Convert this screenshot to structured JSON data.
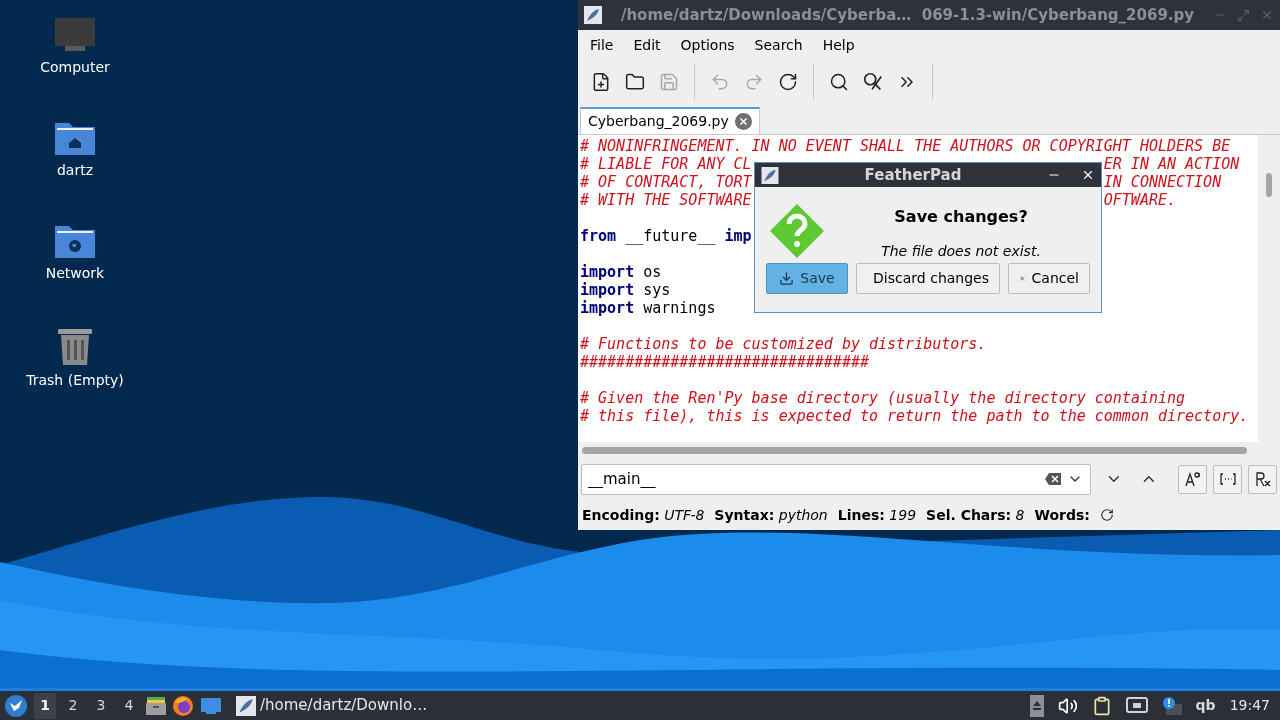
{
  "desktop_icons": [
    {
      "kind": "computer",
      "label": "Computer"
    },
    {
      "kind": "home",
      "label": "dartz"
    },
    {
      "kind": "network",
      "label": "Network"
    },
    {
      "kind": "trash",
      "label": "Trash (Empty)"
    }
  ],
  "editor": {
    "title": "/home/dartz/Downloads/Cyberba…  069-1.3-win/Cyberbang_2069.py",
    "menu": [
      "File",
      "Edit",
      "Options",
      "Search",
      "Help"
    ],
    "toolbar": [
      {
        "kind": "new",
        "disabled": false
      },
      {
        "kind": "open",
        "disabled": false
      },
      {
        "kind": "save",
        "disabled": true
      },
      {
        "kind": "sep"
      },
      {
        "kind": "undo",
        "disabled": true
      },
      {
        "kind": "redo",
        "disabled": true
      },
      {
        "kind": "reload",
        "disabled": false
      },
      {
        "kind": "sep"
      },
      {
        "kind": "find",
        "disabled": false
      },
      {
        "kind": "replace",
        "disabled": false
      },
      {
        "kind": "more",
        "disabled": false
      },
      {
        "kind": "sep"
      }
    ],
    "tabs": [
      {
        "label": "Cyberbang_2069.py",
        "selected": true
      }
    ],
    "lines": [
      {
        "kind": "code",
        "before": [
          {
            "kind": "comment",
            "text": "# NONINFRINGEMENT. IN NO EVENT SHALL THE AUTHORS OR COPYRIGHT HOLDERS BE"
          }
        ]
      },
      {
        "kind": "code",
        "before": [
          {
            "kind": "comment",
            "text": "# LIABLE FOR ANY CL"
          }
        ],
        "after": [
          {
            "kind": "comment",
            "text": "ER IN AN ACTION"
          }
        ]
      },
      {
        "kind": "code",
        "before": [
          {
            "kind": "comment",
            "text": "# OF CONTRACT, TORT"
          }
        ],
        "after": [
          {
            "kind": "comment",
            "text": "IN CONNECTION"
          }
        ]
      },
      {
        "kind": "code",
        "before": [
          {
            "kind": "comment",
            "text": "# WITH THE SOFTWARE"
          }
        ],
        "after": [
          {
            "kind": "comment",
            "text": "OFTWARE."
          }
        ]
      },
      {
        "kind": "blank"
      },
      {
        "kind": "code",
        "before": [
          {
            "kind": "keyword",
            "text": "from"
          },
          {
            "kind": "plain",
            "text": " __future__ "
          },
          {
            "kind": "keyword",
            "text": "imp"
          }
        ]
      },
      {
        "kind": "blank"
      },
      {
        "kind": "code",
        "before": [
          {
            "kind": "keyword",
            "text": "import"
          },
          {
            "kind": "plain",
            "text": " os"
          }
        ]
      },
      {
        "kind": "code",
        "before": [
          {
            "kind": "keyword",
            "text": "import"
          },
          {
            "kind": "plain",
            "text": " sys"
          }
        ]
      },
      {
        "kind": "code",
        "before": [
          {
            "kind": "keyword",
            "text": "import"
          },
          {
            "kind": "plain",
            "text": " warnings"
          }
        ]
      },
      {
        "kind": "blank"
      },
      {
        "kind": "code",
        "before": [
          {
            "kind": "comment",
            "text": "# Functions to be customized by distributors."
          }
        ]
      },
      {
        "kind": "code",
        "before": [
          {
            "kind": "comment",
            "text": "################################"
          }
        ]
      },
      {
        "kind": "blank"
      },
      {
        "kind": "code",
        "before": [
          {
            "kind": "comment",
            "text": "# Given the Ren'Py base directory (usually the directory containing"
          }
        ]
      },
      {
        "kind": "code",
        "before": [
          {
            "kind": "comment",
            "text": "# this file), this is expected to return the path to the common directory."
          }
        ]
      }
    ],
    "search": {
      "value": "__main__"
    },
    "search_toggles": [
      {
        "kind": "case",
        "selected": false
      },
      {
        "kind": "word",
        "selected": false
      },
      {
        "kind": "regex",
        "selected": false
      }
    ],
    "status": [
      {
        "label": "Encoding:",
        "value": "UTF-8"
      },
      {
        "label": "Syntax:",
        "value": "python"
      },
      {
        "label": "Lines:",
        "value": "199"
      },
      {
        "label": "Sel. Chars:",
        "value": "8"
      },
      {
        "label": "Words:"
      }
    ]
  },
  "dialog": {
    "title": "FeatherPad",
    "heading": "Save changes?",
    "message": "The file does not exist.",
    "buttons": [
      {
        "kind": "save",
        "label": "Save",
        "selected": true
      },
      {
        "kind": "discard",
        "label": "Discard changes",
        "selected": false
      },
      {
        "kind": "cancel",
        "label": "Cancel",
        "selected": false
      }
    ]
  },
  "taskbar": {
    "workspaces": [
      {
        "label": "1",
        "selected": true
      },
      {
        "label": "2",
        "selected": false
      },
      {
        "label": "3",
        "selected": false
      },
      {
        "label": "4",
        "selected": false
      }
    ],
    "launchers": [
      {
        "kind": "files"
      },
      {
        "kind": "browser"
      },
      {
        "kind": "desktop"
      }
    ],
    "task": "/home/dartz/Downlo…",
    "tray": [
      {
        "kind": "eject"
      },
      {
        "kind": "volume"
      },
      {
        "kind": "clipboard"
      },
      {
        "kind": "network"
      },
      {
        "kind": "notify"
      },
      {
        "kind": "text",
        "text": "qb"
      }
    ],
    "clock": "19:47"
  }
}
